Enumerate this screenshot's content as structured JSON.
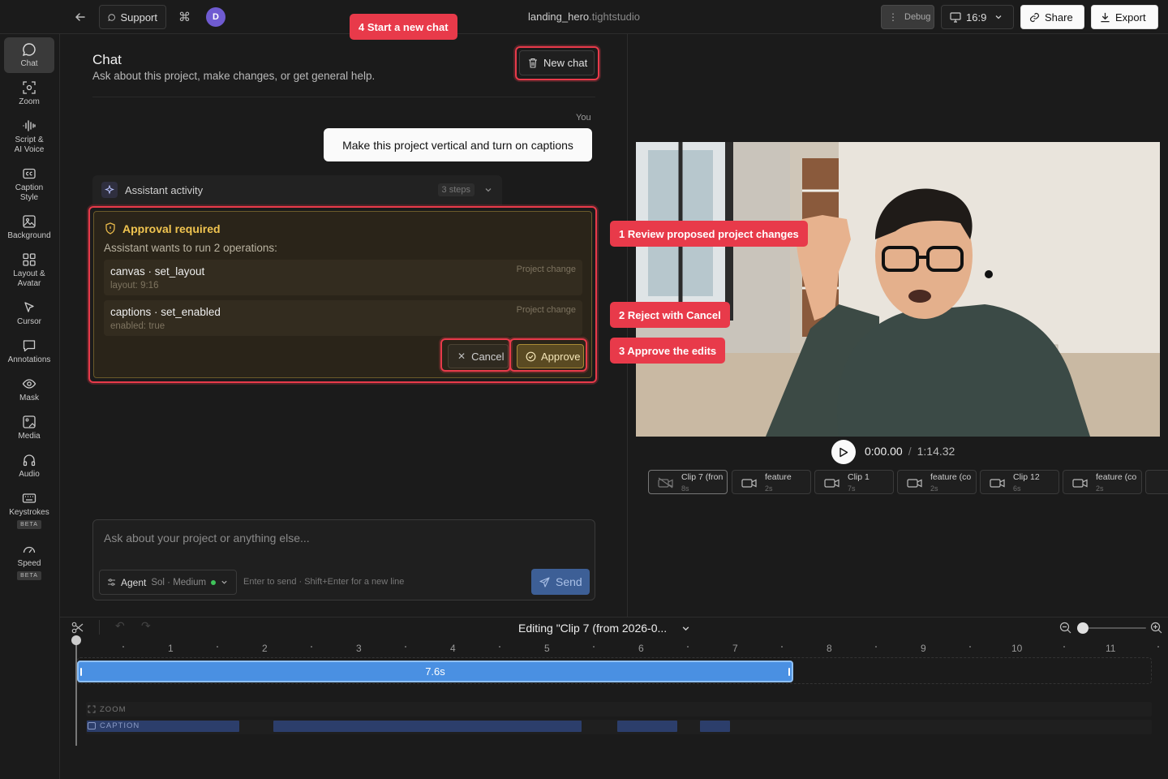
{
  "topbar": {
    "support_label": "Support",
    "avatar_initial": "D",
    "project_name": "landing_hero",
    "project_suffix": ".tightstudio",
    "debug_label": "Debug",
    "aspect_label": "16:9",
    "share_label": "Share",
    "export_label": "Export"
  },
  "sidebar": {
    "items": [
      {
        "label": "Chat",
        "icon": "chat-bubble-icon"
      },
      {
        "label": "Zoom",
        "icon": "zoom-icon"
      },
      {
        "label": "Script &",
        "label2": "AI Voice",
        "icon": "waveform-icon"
      },
      {
        "label": "Caption",
        "label2": "Style",
        "icon": "cc-icon"
      },
      {
        "label": "Background",
        "icon": "image-icon"
      },
      {
        "label": "Layout &",
        "label2": "Avatar",
        "icon": "grid-icon"
      },
      {
        "label": "Cursor",
        "icon": "cursor-icon"
      },
      {
        "label": "Annotations",
        "icon": "comment-icon"
      },
      {
        "label": "Mask",
        "icon": "eye-icon"
      },
      {
        "label": "Media",
        "icon": "media-icon"
      },
      {
        "label": "Audio",
        "icon": "headphones-icon"
      },
      {
        "label": "Keystrokes",
        "badge": "BETA",
        "icon": "keyboard-icon"
      },
      {
        "label": "Speed",
        "badge": "BETA",
        "icon": "speedometer-icon"
      }
    ]
  },
  "chat": {
    "title": "Chat",
    "subtitle": "Ask about this project, make changes, or get general help.",
    "new_chat_label": "New chat",
    "you_label": "You",
    "user_message": "Make this project vertical and turn on captions",
    "activity_label": "Assistant activity",
    "activity_steps": "3 steps",
    "approval": {
      "title": "Approval required",
      "description": "Assistant wants to run 2 operations:",
      "operations": [
        {
          "name": "canvas · set_layout",
          "value": "layout: 9:16",
          "tag": "Project change"
        },
        {
          "name": "captions · set_enabled",
          "value": "enabled: true",
          "tag": "Project change"
        }
      ],
      "cancel_label": "Cancel",
      "approve_label": "Approve"
    },
    "input_placeholder": "Ask about your project or anything else...",
    "agent_label": "Agent",
    "agent_model": "Sol · Medium",
    "hint": "Enter to send · Shift+Enter for a new line",
    "send_label": "Send"
  },
  "callouts": {
    "c1": "1 Review proposed project changes",
    "c2": "2 Reject with Cancel",
    "c3": "3 Approve the edits",
    "c4": "4 Start a new chat"
  },
  "player": {
    "current_time": "0:00.00",
    "separator": "/",
    "duration": "1:14.32"
  },
  "clips": [
    {
      "name": "Clip 7 (fron",
      "duration": "8s"
    },
    {
      "name": "feature",
      "duration": "2s"
    },
    {
      "name": "Clip 1",
      "duration": "7s"
    },
    {
      "name": "feature (co",
      "duration": "2s"
    },
    {
      "name": "Clip 12",
      "duration": "6s"
    },
    {
      "name": "feature (co",
      "duration": "2s"
    }
  ],
  "timeline": {
    "editing_label": "Editing \"Clip 7 (from 2026-0...",
    "ticks": [
      "1",
      "2",
      "3",
      "4",
      "5",
      "6",
      "7",
      "8",
      "9",
      "10",
      "11"
    ],
    "clip_duration": "7.6s",
    "zoom_track_label": "ZOOM",
    "caption_track_label": "CAPTION",
    "zoom_level": 0.0
  },
  "colors": {
    "accent_blue": "#4a90e2",
    "annotation_red": "#e83a4a",
    "approval_gold": "#e8b94a",
    "send_blue": "#3d5f96"
  }
}
